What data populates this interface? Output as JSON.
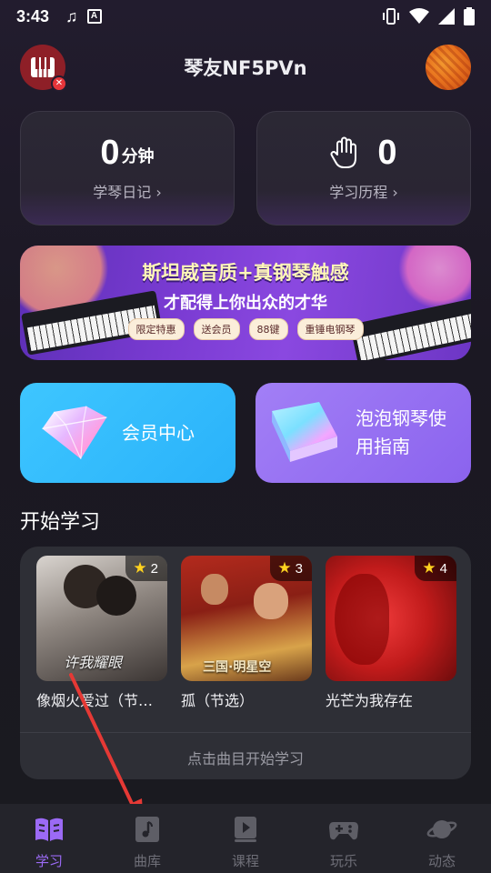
{
  "status_bar": {
    "time": "3:43",
    "icons": [
      "music-note-icon",
      "a-icon",
      "vibrate-icon",
      "wifi-icon",
      "signal-icon",
      "battery-icon"
    ]
  },
  "header": {
    "title": "琴友NF5PVn",
    "left_icon": "piano-icon",
    "right_avatar": "user-avatar"
  },
  "stats": {
    "practice": {
      "value": "0",
      "unit": "分钟",
      "link": "学琴日记 ›"
    },
    "history": {
      "value": "0",
      "link": "学习历程 ›",
      "icon": "hand-icon"
    }
  },
  "banner": {
    "title": "斯坦威音质+真钢琴触感",
    "subtitle": "才配得上你出众的才华",
    "tags": [
      "限定特惠",
      "送会员",
      "88键",
      "重锤电钢琴"
    ]
  },
  "features": {
    "vip": {
      "label": "会员中心",
      "icon": "diamond-icon"
    },
    "guide": {
      "label": "泡泡钢琴使用指南",
      "icon": "book-icon"
    }
  },
  "section": {
    "title": "开始学习",
    "hint": "点击曲目开始学习"
  },
  "songs": [
    {
      "title": "像烟火爱过（节…",
      "stars": "2",
      "cover_text": "许我耀眼"
    },
    {
      "title": "孤（节选）",
      "stars": "3",
      "cover_text": "三国·明星空"
    },
    {
      "title": "光芒为我存在",
      "stars": "4",
      "cover_text": ""
    }
  ],
  "nav": [
    {
      "label": "学习",
      "icon": "book-open-icon",
      "active": true
    },
    {
      "label": "曲库",
      "icon": "music-library-icon",
      "active": false
    },
    {
      "label": "课程",
      "icon": "course-play-icon",
      "active": false
    },
    {
      "label": "玩乐",
      "icon": "gamepad-icon",
      "active": false
    },
    {
      "label": "动态",
      "icon": "planet-icon",
      "active": false
    }
  ],
  "colors": {
    "accent": "#9b6af5",
    "vip_card": "#2ab2fa",
    "guide_card": "#8b63ee",
    "arrow": "#e53935",
    "star": "#ffd21f"
  }
}
